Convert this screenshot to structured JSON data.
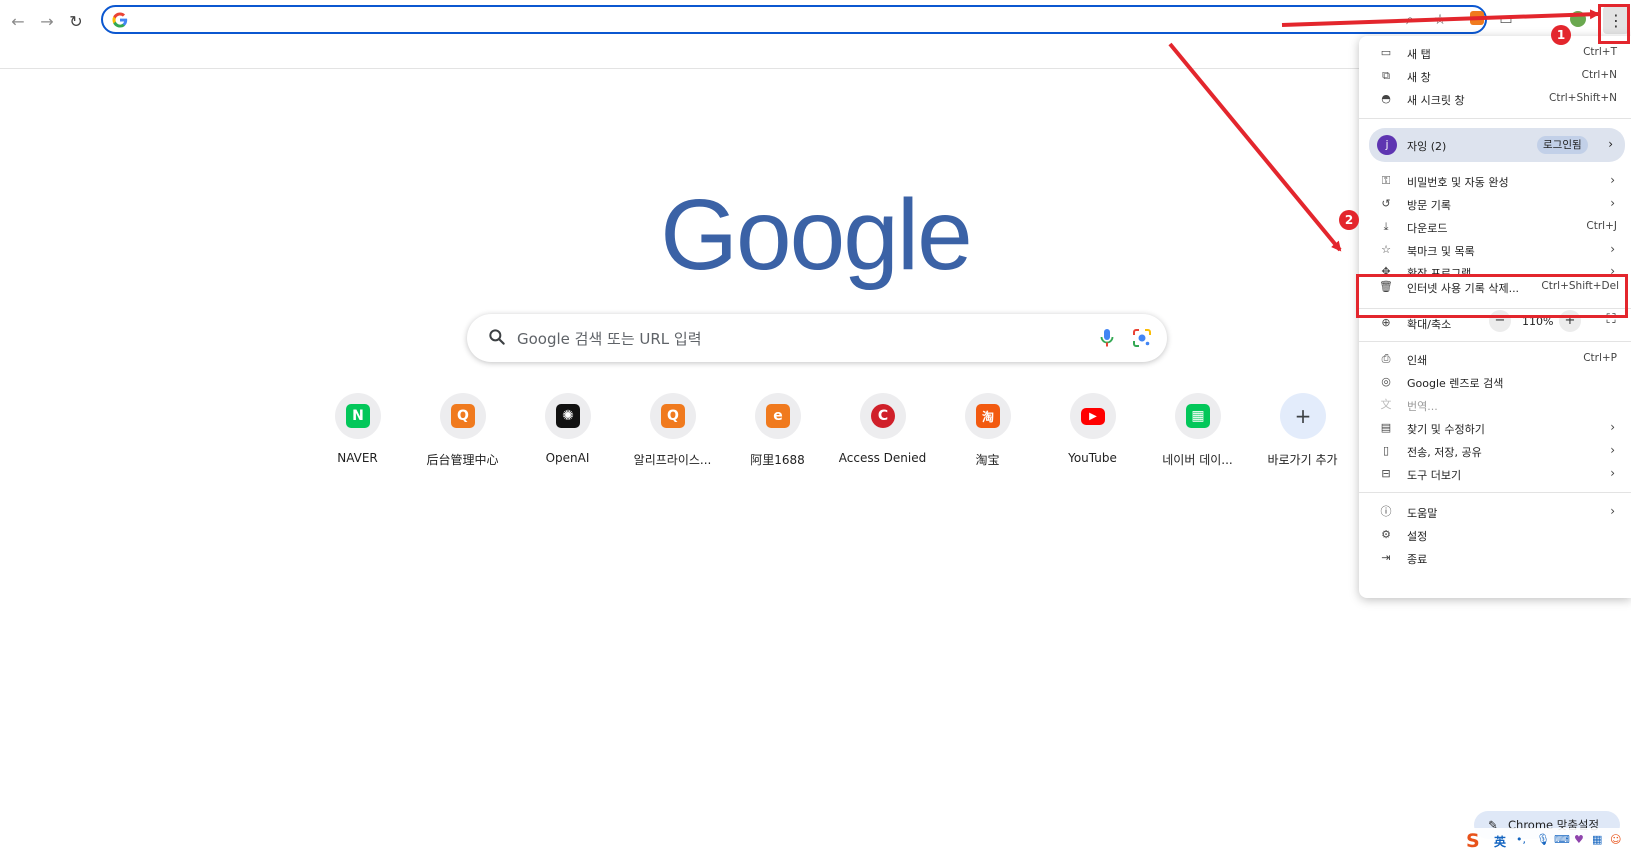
{
  "toolbar": {
    "back": "←",
    "forward": "→",
    "reload": "↻",
    "menu": "⋮"
  },
  "search": {
    "placeholder": "Google 검색 또는 URL 입력"
  },
  "logo": "Google",
  "shortcuts": [
    {
      "label": "NAVER",
      "glyph": "N",
      "color": "#03c75a"
    },
    {
      "label": "后台管理中心",
      "glyph": "Q",
      "color": "#f07a1e"
    },
    {
      "label": "OpenAI",
      "glyph": "✺",
      "color": "#111111"
    },
    {
      "label": "알리프라이스...",
      "glyph": "Q",
      "color": "#f07a1e"
    },
    {
      "label": "阿里1688",
      "glyph": "e",
      "color": "#f07a1e"
    },
    {
      "label": "Access Denied",
      "glyph": "C",
      "color": "#d0202a"
    },
    {
      "label": "淘宝",
      "glyph": "淘",
      "color": "#f25a10"
    },
    {
      "label": "YouTube",
      "glyph": "▶",
      "color": "#ff0000"
    },
    {
      "label": "네이버 데이...",
      "glyph": "▦",
      "color": "#03c75a"
    },
    {
      "label": "바로가기 추가",
      "glyph": "+",
      "color": "#3c4043"
    }
  ],
  "menu": {
    "new_tab": {
      "label": "새 탭",
      "shortcut": "Ctrl+T"
    },
    "new_window": {
      "label": "새 창",
      "shortcut": "Ctrl+N"
    },
    "incognito": {
      "label": "새 시크릿 창",
      "shortcut": "Ctrl+Shift+N"
    },
    "profile": {
      "avatar": "j",
      "name": "자잉 (2)",
      "login": "로그인됨"
    },
    "passwords": {
      "label": "비밀번호 및 자동 완성"
    },
    "history": {
      "label": "방문 기록"
    },
    "downloads": {
      "label": "다운로드",
      "shortcut": "Ctrl+J"
    },
    "bookmarks": {
      "label": "북마크 및 목록"
    },
    "extensions": {
      "label": "확장 프로그램"
    },
    "clear_data": {
      "label": "인터넷 사용 기록 삭제...",
      "shortcut": "Ctrl+Shift+Del"
    },
    "zoom": {
      "label": "확대/축소",
      "value": "110%",
      "minus": "−",
      "plus": "+"
    },
    "print": {
      "label": "인쇄",
      "shortcut": "Ctrl+P"
    },
    "lens": {
      "label": "Google 렌즈로 검색"
    },
    "translate": {
      "label": "번역..."
    },
    "find_edit": {
      "label": "찾기 및 수정하기"
    },
    "cast_save": {
      "label": "전송, 저장, 공유"
    },
    "more_tools": {
      "label": "도구 더보기"
    },
    "help": {
      "label": "도움말"
    },
    "settings": {
      "label": "설정"
    },
    "exit": {
      "label": "종료"
    }
  },
  "annotations": {
    "step1": "1",
    "step2": "2"
  },
  "customize": {
    "label": "Chrome 맞춤설정"
  },
  "ime": {
    "logo": "S",
    "lang": "英"
  },
  "colors": {
    "accent": "#0b57d0",
    "annotation": "#e3262d"
  }
}
